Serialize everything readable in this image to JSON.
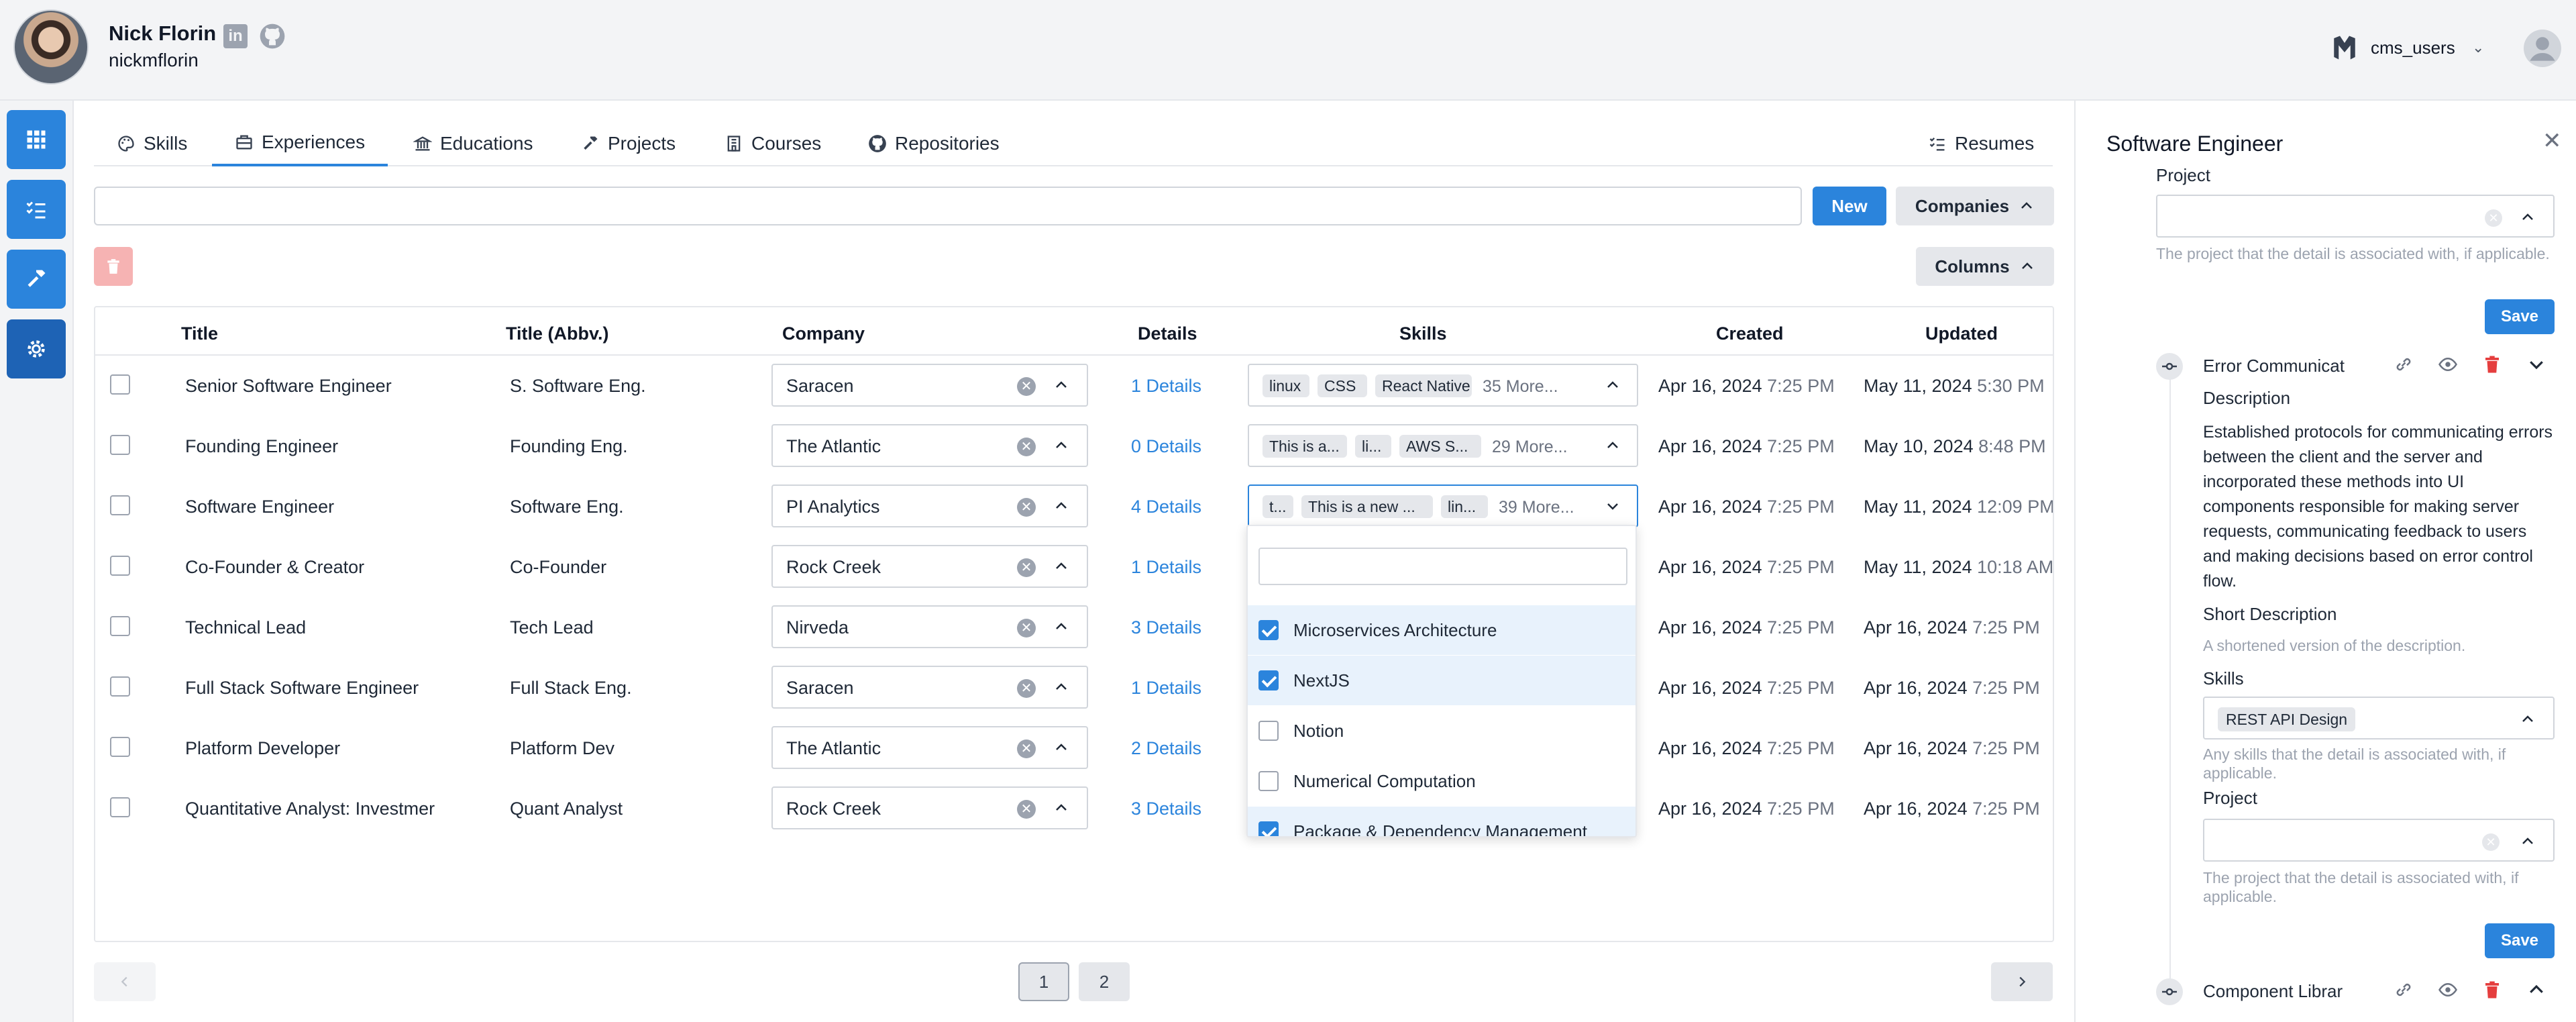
{
  "user": {
    "name": "Nick Florin",
    "handle": "nickmflorin"
  },
  "org": {
    "name": "cms_users"
  },
  "nav": [
    {
      "icon": "grid-icon"
    },
    {
      "icon": "checklist-icon"
    },
    {
      "icon": "hammer-icon"
    },
    {
      "icon": "gear-icon"
    }
  ],
  "tabs": {
    "skills": "Skills",
    "experiences": "Experiences",
    "educations": "Educations",
    "projects": "Projects",
    "courses": "Courses",
    "repositories": "Repositories",
    "resumes": "Resumes"
  },
  "toolbar": {
    "new_label": "New",
    "companies_label": "Companies",
    "columns_label": "Columns",
    "search_value": ""
  },
  "table": {
    "headers": {
      "title": "Title",
      "abbv": "Title (Abbv.)",
      "company": "Company",
      "details": "Details",
      "skills": "Skills",
      "created": "Created",
      "updated": "Updated"
    },
    "rows": [
      {
        "title": "Senior Software Engineer",
        "abbv": "S. Software Eng.",
        "company": "Saracen",
        "details": "1 Details",
        "pills": [
          "linux",
          "CSS",
          "React Native"
        ],
        "more": "35 More...",
        "created_date": "Apr 16, 2024",
        "created_time": "7:25 PM",
        "updated_date": "May 11, 2024",
        "updated_time": "5:30 PM"
      },
      {
        "title": "Founding Engineer",
        "abbv": "Founding Eng.",
        "company": "The Atlantic",
        "details": "0 Details",
        "pills": [
          "This is a...",
          "li...",
          "AWS S..."
        ],
        "more": "29 More...",
        "created_date": "Apr 16, 2024",
        "created_time": "7:25 PM",
        "updated_date": "May 10, 2024",
        "updated_time": "8:48 PM"
      },
      {
        "title": "Software Engineer",
        "abbv": "Software Eng.",
        "company": "PI Analytics",
        "details": "4 Details",
        "pills": [
          "t...",
          "This is a new ...",
          "lin..."
        ],
        "more": "39 More...",
        "created_date": "Apr 16, 2024",
        "created_time": "7:25 PM",
        "updated_date": "May 11, 2024",
        "updated_time": "12:09 PM"
      },
      {
        "title": "Co-Founder & Creator",
        "abbv": "Co-Founder",
        "company": "Rock Creek",
        "details": "1 Details",
        "created_date": "Apr 16, 2024",
        "created_time": "7:25 PM",
        "updated_date": "May 11, 2024",
        "updated_time": "10:18 AM"
      },
      {
        "title": "Technical Lead",
        "abbv": "Tech Lead",
        "company": "Nirveda",
        "details": "3 Details",
        "created_date": "Apr 16, 2024",
        "created_time": "7:25 PM",
        "updated_date": "Apr 16, 2024",
        "updated_time": "7:25 PM"
      },
      {
        "title": "Full Stack Software Engineer",
        "abbv": "Full Stack Eng.",
        "company": "Saracen",
        "details": "1 Details",
        "created_date": "Apr 16, 2024",
        "created_time": "7:25 PM",
        "updated_date": "Apr 16, 2024",
        "updated_time": "7:25 PM"
      },
      {
        "title": "Platform Developer",
        "abbv": "Platform Dev",
        "company": "The Atlantic",
        "details": "2 Details",
        "created_date": "Apr 16, 2024",
        "created_time": "7:25 PM",
        "updated_date": "Apr 16, 2024",
        "updated_time": "7:25 PM"
      },
      {
        "title": "Quantitative Analyst: Investmer",
        "abbv": "Quant Analyst",
        "company": "Rock Creek",
        "details": "3 Details",
        "created_date": "Apr 16, 2024",
        "created_time": "7:25 PM",
        "updated_date": "Apr 16, 2024",
        "updated_time": "7:25 PM"
      }
    ]
  },
  "dropdown": {
    "search_value": "",
    "options": [
      {
        "label": "Microservices Architecture",
        "checked": true
      },
      {
        "label": "NextJS",
        "checked": true
      },
      {
        "label": "Notion",
        "checked": false
      },
      {
        "label": "Numerical Computation",
        "checked": false
      },
      {
        "label": "Package & Dependency Management",
        "checked": true
      }
    ]
  },
  "pagination": {
    "pages": [
      "1",
      "2"
    ],
    "current": "1"
  },
  "drawer": {
    "title": "Software Engineer",
    "top_project_label": "Project",
    "top_project_help": "The project that the detail is associated with, if applicable.",
    "save_label": "Save",
    "item1_title": "Error Communicat",
    "description_label": "Description",
    "description": "Established protocols for communicating errors between the client and the server and incorporated these methods into UI components responsible for making server requests, communicating feedback to users and making decisions based on error control flow.",
    "short_description_label": "Short Description",
    "short_description_placeholder": "A shortened version of the description.",
    "skills_label": "Skills",
    "skills_pill": "REST API Design",
    "skills_help": "Any skills that the detail is associated with, if applicable.",
    "project_label": "Project",
    "project_help": "The project that the detail is associated with, if applicable.",
    "item2_title": "Component Librar"
  },
  "colors": {
    "accent": "#2b84dc",
    "nav_active": "#1e63b5",
    "danger": "#e53e3e"
  }
}
